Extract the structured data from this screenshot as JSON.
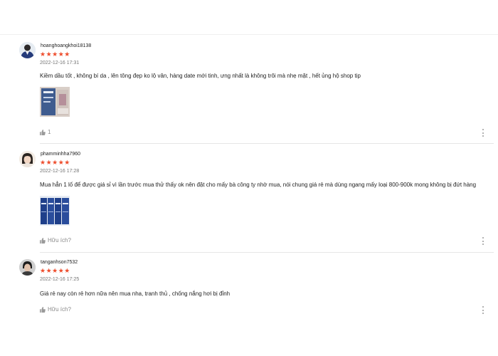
{
  "reviews": [
    {
      "username": "hoanghoangkhoi18138",
      "stars": "★★★★★",
      "date": "2022-12-16 17:31",
      "comment": "Kiềm dầu tốt , không bí da , lên tông đẹp ko lộ vân, hàng date mới tinh, ưng nhất là không trôi mà nhẹ mặt , hết ủng hộ shop tip",
      "like_count": "1",
      "like_label": ""
    },
    {
      "username": "phamminhha7960",
      "stars": "★★★★★",
      "date": "2022-12-16 17:28",
      "comment": "Mua hẳn 1 lố để được giá sỉ vì lần trước mua thử thấy ok nên đặt cho mấy bà công ty nhờ mua, nói chung giá rẻ mà dùng ngang mấy loại 800-900k mong không bị đứt hàng",
      "like_count": "",
      "like_label": "Hữu ích?"
    },
    {
      "username": "tanganhson7532",
      "stars": "★★★★★",
      "date": "2022-12-16 17:25",
      "comment": "Giá rẻ nay còn rẻ hơn nữa nên mua nha, tranh thủ , chống nắng hơi bị đỉnh",
      "like_count": "",
      "like_label": "Hữu ích?"
    }
  ],
  "colors": {
    "star": "#ee4d2d",
    "muted": "#757575",
    "divider": "#e6e6e6"
  },
  "icons": {
    "like": "thumbs-up-icon",
    "more": "more-vertical-icon"
  }
}
